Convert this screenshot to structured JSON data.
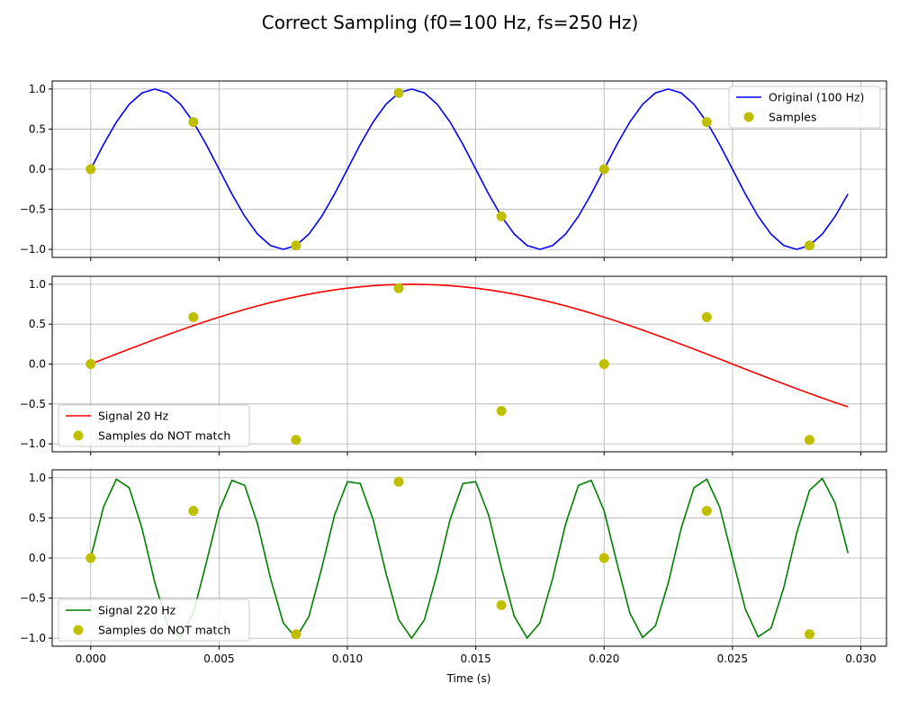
{
  "title": "Correct Sampling (f0=100 Hz, fs=250 Hz)",
  "xlabel": "Time (s)",
  "xticks": [
    "0.000",
    "0.005",
    "0.010",
    "0.015",
    "0.020",
    "0.025",
    "0.030"
  ],
  "yticks": [
    "1.0",
    "0.5",
    "0.0",
    "−0.5",
    "−1.0"
  ],
  "colors": {
    "blue": "#0000ff",
    "red": "#ff0000",
    "green": "#008000",
    "samples": "#bfbf00",
    "grid": "#b0b0b0"
  },
  "chart_data": [
    {
      "type": "line",
      "x_range": [
        -0.0015,
        0.031
      ],
      "ylim": [
        -1.1,
        1.1
      ],
      "grid": true,
      "legend_placement": "upper right",
      "series": [
        {
          "name": "Original (100 Hz)",
          "kind": "line",
          "color": "#0000ff",
          "frequency_hz": 100,
          "t_start": 0,
          "t_step": 0.0005,
          "n_points": 60
        },
        {
          "name": "Samples",
          "kind": "markers",
          "color": "#bfbf00",
          "x": [
            0.0,
            0.004,
            0.008,
            0.012,
            0.016,
            0.02,
            0.024,
            0.028
          ],
          "y": [
            0.0,
            0.588,
            -0.951,
            0.951,
            -0.588,
            0.0,
            0.588,
            -0.951
          ]
        }
      ]
    },
    {
      "type": "line",
      "x_range": [
        -0.0015,
        0.031
      ],
      "ylim": [
        -1.1,
        1.1
      ],
      "grid": true,
      "legend_placement": "lower left",
      "series": [
        {
          "name": "Signal 20 Hz",
          "kind": "line",
          "color": "#ff0000",
          "frequency_hz": 20,
          "t_start": 0,
          "t_step": 0.0005,
          "n_points": 60
        },
        {
          "name": "Samples do NOT match",
          "kind": "markers",
          "color": "#bfbf00",
          "x": [
            0.0,
            0.004,
            0.008,
            0.012,
            0.016,
            0.02,
            0.024,
            0.028
          ],
          "y": [
            0.0,
            0.588,
            -0.951,
            0.951,
            -0.588,
            0.0,
            0.588,
            -0.951
          ]
        }
      ]
    },
    {
      "type": "line",
      "x_range": [
        -0.0015,
        0.031
      ],
      "ylim": [
        -1.1,
        1.1
      ],
      "grid": true,
      "legend_placement": "lower left",
      "series": [
        {
          "name": "Signal 220 Hz",
          "kind": "line",
          "color": "#008000",
          "frequency_hz": 220,
          "t_start": 0,
          "t_step": 0.0005,
          "n_points": 60
        },
        {
          "name": "Samples do NOT match",
          "kind": "markers",
          "color": "#bfbf00",
          "x": [
            0.0,
            0.004,
            0.008,
            0.012,
            0.016,
            0.02,
            0.024,
            0.028
          ],
          "y": [
            0.0,
            0.588,
            -0.951,
            0.951,
            -0.588,
            0.0,
            0.588,
            -0.951
          ]
        }
      ]
    }
  ]
}
